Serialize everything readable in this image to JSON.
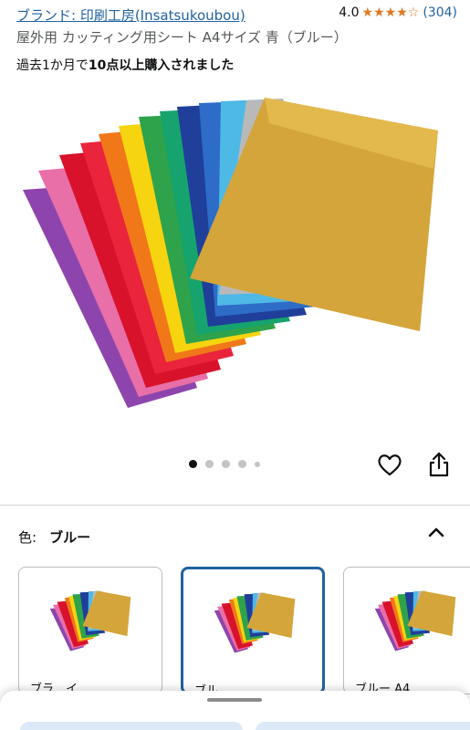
{
  "header": {
    "brand_link": "ブランド: 印刷工房(Insatsukoubou)",
    "rating_value": "4.0",
    "rating_stars": 4,
    "rating_count": "(304)"
  },
  "product": {
    "title": "屋外用 カッティング用シート A4サイズ 青（ブルー）",
    "bought_prefix": "過去1か月で",
    "bought_strong": "10点以上購入されました"
  },
  "gallery": {
    "image_count": 5,
    "active_index": 0,
    "sheet_colors": [
      "#8e44ad",
      "#e86fa8",
      "#d9122b",
      "#e9243b",
      "#f07819",
      "#f6d40f",
      "#2ea34b",
      "#17a36e",
      "#1f3f9a",
      "#2d6cc7",
      "#4fb9e6",
      "#b9b9b9",
      "#d4a53a"
    ]
  },
  "actions": {
    "favorite_icon": "heart-icon",
    "share_icon": "share-icon"
  },
  "variants": {
    "color_label": "色:",
    "selected_color": "ブルー",
    "toggle_icon": "chevron-up-icon",
    "options": [
      {
        "label": "ブラ…イ…",
        "selected": false
      },
      {
        "label": "ブル…",
        "selected": true
      },
      {
        "label": "ブルー A4…",
        "selected": false
      }
    ]
  },
  "colors": {
    "link": "#2162a1",
    "star": "#de7921",
    "selected_border": "#2162a1"
  }
}
